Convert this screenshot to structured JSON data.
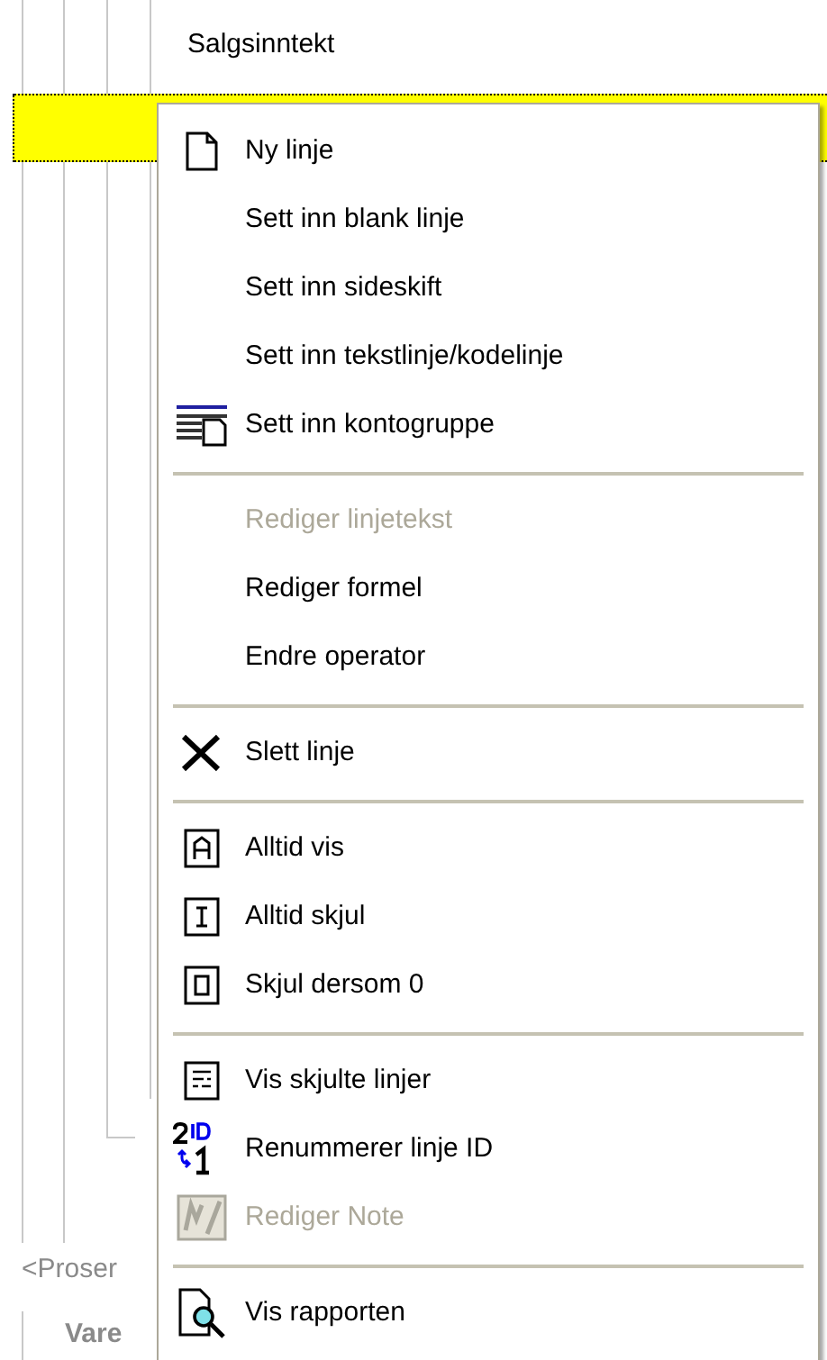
{
  "report_tree": {
    "row_label": "Salgsinntekt",
    "selected_row": {
      "selected": true
    },
    "partial_labels": [
      {
        "text": "<Proser",
        "kind": "plain"
      },
      {
        "text": "Vare",
        "kind": "bold"
      }
    ]
  },
  "context_menu": {
    "items": [
      {
        "kind": "item",
        "label": "Ny linje",
        "disabled": false
      },
      {
        "kind": "item",
        "label": "Sett inn blank linje",
        "disabled": false
      },
      {
        "kind": "item",
        "label": "Sett inn sideskift",
        "disabled": false
      },
      {
        "kind": "item",
        "label": "Sett inn tekstlinje/kodelinje",
        "disabled": false
      },
      {
        "kind": "item",
        "label": "Sett inn kontogruppe",
        "disabled": false
      },
      {
        "kind": "separator"
      },
      {
        "kind": "item",
        "label": "Rediger linjetekst",
        "disabled": true
      },
      {
        "kind": "item",
        "label": "Rediger formel",
        "disabled": false
      },
      {
        "kind": "item",
        "label": "Endre operator",
        "disabled": false
      },
      {
        "kind": "separator"
      },
      {
        "kind": "item",
        "label": "Slett linje",
        "disabled": false
      },
      {
        "kind": "separator"
      },
      {
        "kind": "item",
        "label": "Alltid vis",
        "disabled": false
      },
      {
        "kind": "item",
        "label": "Alltid skjul",
        "disabled": false
      },
      {
        "kind": "item",
        "label": "Skjul dersom 0",
        "disabled": false
      },
      {
        "kind": "separator"
      },
      {
        "kind": "item",
        "label": "Vis skjulte linjer",
        "disabled": false
      },
      {
        "kind": "item",
        "label": "Renummerer linje ID",
        "disabled": false
      },
      {
        "kind": "item",
        "label": "Rediger Note",
        "disabled": true
      },
      {
        "kind": "separator"
      },
      {
        "kind": "item",
        "label": "Vis rapporten",
        "disabled": false
      }
    ]
  }
}
